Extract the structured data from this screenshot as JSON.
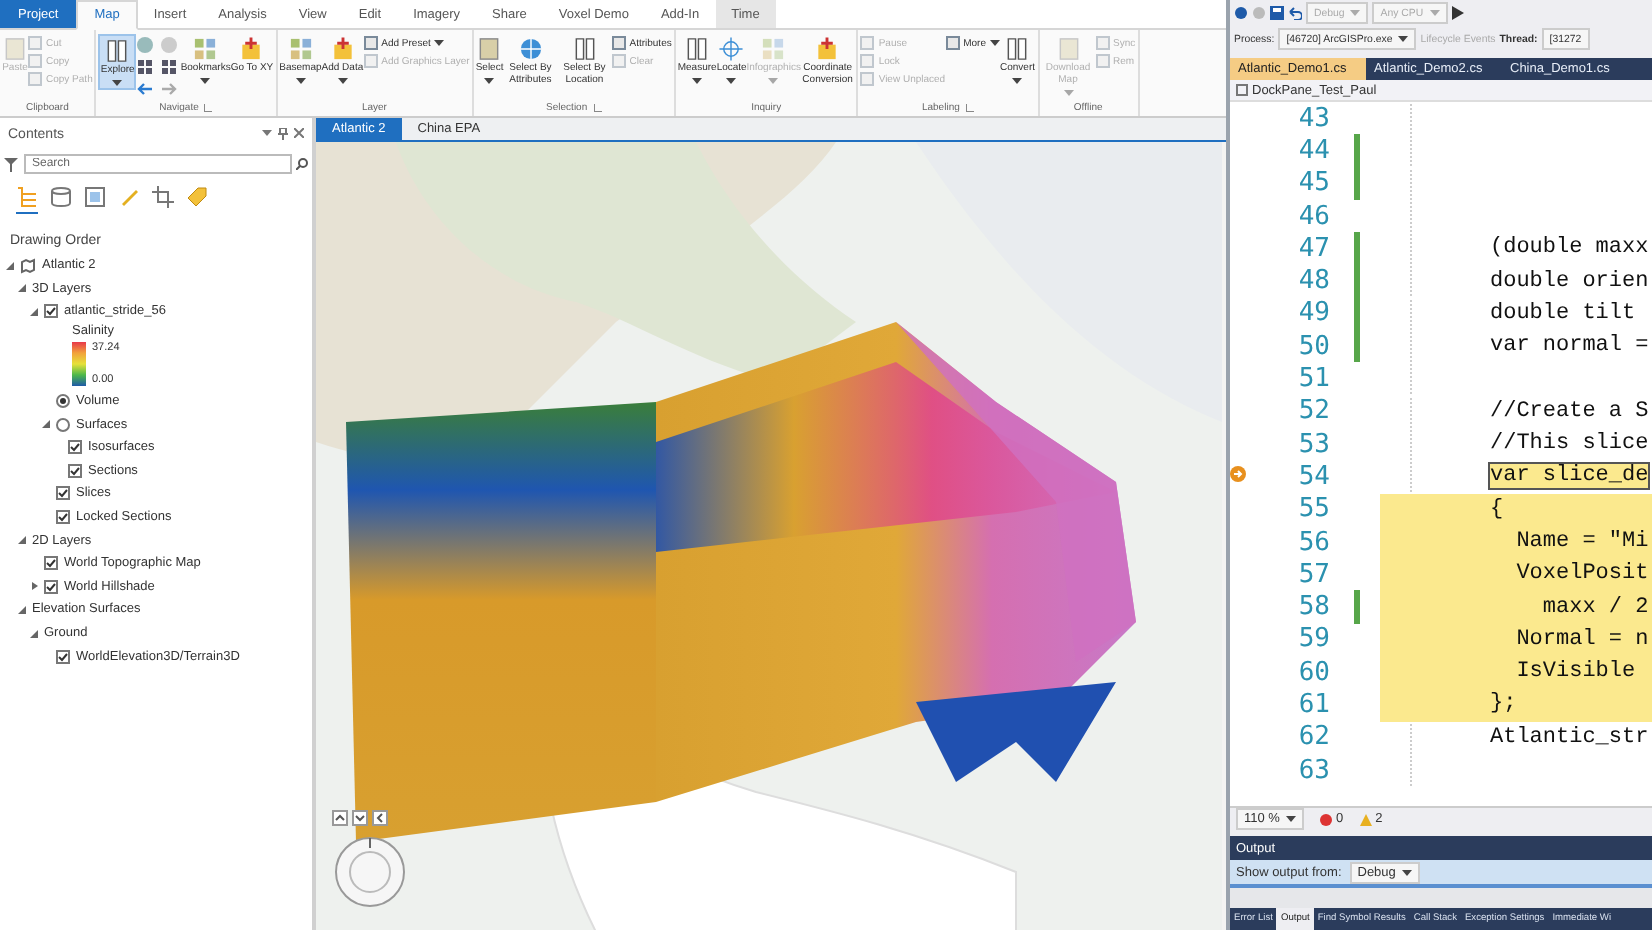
{
  "arcgis": {
    "tabs": [
      {
        "label": "Project",
        "kind": "file",
        "selected": false
      },
      {
        "label": "Map",
        "kind": "tab",
        "selected": true
      },
      {
        "label": "Insert",
        "kind": "tab",
        "selected": false
      },
      {
        "label": "Analysis",
        "kind": "tab",
        "selected": false
      },
      {
        "label": "View",
        "kind": "tab",
        "selected": false
      },
      {
        "label": "Edit",
        "kind": "tab",
        "selected": false
      },
      {
        "label": "Imagery",
        "kind": "tab",
        "selected": false
      },
      {
        "label": "Share",
        "kind": "tab",
        "selected": false
      },
      {
        "label": "Voxel Demo",
        "kind": "tab",
        "selected": false
      },
      {
        "label": "Add-In",
        "kind": "tab",
        "selected": false
      },
      {
        "label": "Time",
        "kind": "contextual",
        "selected": false
      }
    ],
    "ribbon": [
      {
        "label": "Clipboard",
        "launcher": false,
        "tools": [
          {
            "kind": "large",
            "label": "Paste",
            "disabled": true,
            "dropdown": false
          },
          {
            "kind": "small",
            "label": "Cut",
            "disabled": true,
            "dropdown": false
          },
          {
            "kind": "small",
            "label": "Copy",
            "disabled": true,
            "dropdown": false
          },
          {
            "kind": "small",
            "label": "Copy Path",
            "disabled": true,
            "dropdown": false
          }
        ]
      },
      {
        "label": "Navigate",
        "launcher": true,
        "tools": [
          {
            "kind": "large",
            "label": "Explore",
            "disabled": false,
            "dropdown": true,
            "active": true
          },
          {
            "kind": "nav_icons"
          },
          {
            "kind": "large",
            "label": "Bookmarks",
            "disabled": false,
            "dropdown": true,
            "active": false
          },
          {
            "kind": "large",
            "label": "Go To XY",
            "disabled": false,
            "dropdown": false,
            "active": false
          }
        ]
      },
      {
        "label": "Layer",
        "launcher": false,
        "tools": [
          {
            "kind": "large",
            "label": "Basemap",
            "disabled": false,
            "dropdown": true
          },
          {
            "kind": "large",
            "label": "Add Data",
            "disabled": false,
            "dropdown": true
          },
          {
            "kind": "small",
            "label": "Add Preset",
            "disabled": false,
            "dropdown": true
          },
          {
            "kind": "small",
            "label": "Add Graphics Layer",
            "disabled": true,
            "dropdown": false
          }
        ]
      },
      {
        "label": "Selection",
        "launcher": true,
        "tools": [
          {
            "kind": "large",
            "label": "Select",
            "disabled": false,
            "dropdown": true
          },
          {
            "kind": "large",
            "label": "Select By Attributes",
            "disabled": false,
            "dropdown": false
          },
          {
            "kind": "large",
            "label": "Select By Location",
            "disabled": false,
            "dropdown": false
          },
          {
            "kind": "small",
            "label": "Attributes",
            "disabled": false,
            "dropdown": false
          },
          {
            "kind": "small",
            "label": "Clear",
            "disabled": true,
            "dropdown": false
          }
        ]
      },
      {
        "label": "Inquiry",
        "launcher": false,
        "tools": [
          {
            "kind": "large",
            "label": "Measure",
            "disabled": false,
            "dropdown": true
          },
          {
            "kind": "large",
            "label": "Locate",
            "disabled": false,
            "dropdown": true
          },
          {
            "kind": "large",
            "label": "Infographics",
            "disabled": true,
            "dropdown": true
          },
          {
            "kind": "large",
            "label": "Coordinate Conversion",
            "disabled": false,
            "dropdown": false
          }
        ]
      },
      {
        "label": "Labeling",
        "launcher": true,
        "tools": [
          {
            "kind": "small",
            "label": "Pause",
            "disabled": true,
            "dropdown": false
          },
          {
            "kind": "small",
            "label": "Lock",
            "disabled": true,
            "dropdown": false
          },
          {
            "kind": "small",
            "label": "View Unplaced",
            "disabled": true,
            "dropdown": false
          },
          {
            "kind": "small",
            "label": "More",
            "disabled": false,
            "dropdown": true
          },
          {
            "kind": "large",
            "label": "Convert",
            "disabled": false,
            "dropdown": true
          }
        ]
      },
      {
        "label": "Offline",
        "launcher": false,
        "tools": [
          {
            "kind": "large",
            "label": "Download Map",
            "disabled": true,
            "dropdown": true
          },
          {
            "kind": "small",
            "label": "Sync",
            "disabled": true,
            "dropdown": false
          },
          {
            "kind": "small",
            "label": "Rem",
            "disabled": true,
            "dropdown": false
          }
        ]
      }
    ],
    "contents": {
      "title": "Contents",
      "search_placeholder": "Search",
      "view_tabs": [
        {
          "selected": true
        },
        {
          "selected": false
        },
        {
          "selected": false
        },
        {
          "selected": false
        },
        {
          "selected": false
        },
        {
          "selected": false
        }
      ],
      "heading": "Drawing Order",
      "tree": [
        {
          "label": "Atlantic 2",
          "kind": "map",
          "expanded": true,
          "children": [
            {
              "label": "3D Layers",
              "kind": "group",
              "expanded": true,
              "children": [
                {
                  "label": "atlantic_stride_56",
                  "kind": "layer",
                  "expanded": true,
                  "checked": true,
                  "legend": {
                    "title": "Salinity",
                    "max": "37.24",
                    "min": "0.00"
                  },
                  "children": [
                    {
                      "label": "Volume",
                      "kind": "option",
                      "selected": true
                    },
                    {
                      "label": "Surfaces",
                      "kind": "option",
                      "selected": false,
                      "expanded": true,
                      "children": [
                        {
                          "label": "Isosurfaces",
                          "kind": "layer",
                          "checked": true
                        },
                        {
                          "label": "Sections",
                          "kind": "layer",
                          "checked": true
                        }
                      ]
                    },
                    {
                      "label": "Slices",
                      "kind": "layer",
                      "checked": true
                    },
                    {
                      "label": "Locked Sections",
                      "kind": "layer",
                      "checked": true
                    }
                  ]
                }
              ]
            },
            {
              "label": "2D Layers",
              "kind": "group",
              "expanded": true,
              "children": [
                {
                  "label": "World Topographic Map",
                  "kind": "layer",
                  "checked": true
                },
                {
                  "label": "World Hillshade",
                  "kind": "layer",
                  "checked": true,
                  "expanded": false
                }
              ]
            },
            {
              "label": "Elevation Surfaces",
              "kind": "group",
              "expanded": true,
              "children": [
                {
                  "label": "Ground",
                  "kind": "group",
                  "expanded": true,
                  "children": [
                    {
                      "label": "WorldElevation3D/Terrain3D",
                      "kind": "layer",
                      "checked": true
                    }
                  ]
                }
              ]
            }
          ]
        }
      ]
    },
    "map": {
      "tabs": [
        {
          "label": "Atlantic 2",
          "selected": true
        },
        {
          "label": "China EPA",
          "selected": false
        }
      ]
    }
  },
  "ide": {
    "toolbar": {
      "config": "Debug",
      "platform": "Any CPU",
      "process_label": "Process:",
      "process": "[46720] ArcGISPro.exe",
      "lifecycle": "Lifecycle Events",
      "thread_label": "Thread:",
      "thread": "[31272"
    },
    "doc_tabs": [
      {
        "label": "Atlantic_Demo1.cs",
        "selected": true
      },
      {
        "label": "Atlantic_Demo2.cs",
        "selected": false
      },
      {
        "label": "China_Demo1.cs",
        "selected": false
      }
    ],
    "nav": "DockPane_Test_Paul",
    "lines": [
      {
        "number": "43",
        "changed": false,
        "filled": false,
        "outlined": false,
        "marker": false
      },
      {
        "number": "44",
        "changed": true,
        "filled": false,
        "outlined": false,
        "marker": false
      },
      {
        "number": "45",
        "changed": true,
        "filled": false,
        "outlined": false,
        "marker": false
      },
      {
        "number": "46",
        "changed": false,
        "filled": false,
        "outlined": false,
        "marker": false
      },
      {
        "number": "47",
        "text": "(double maxx",
        "changed": true,
        "filled": false,
        "outlined": false,
        "marker": false
      },
      {
        "number": "48",
        "text": "double orien",
        "changed": true,
        "filled": false,
        "outlined": false,
        "marker": false
      },
      {
        "number": "49",
        "text": "double tilt",
        "changed": true,
        "filled": false,
        "outlined": false,
        "marker": false
      },
      {
        "number": "50",
        "text": "var normal =",
        "changed": true,
        "filled": false,
        "outlined": false,
        "marker": false
      },
      {
        "number": "51",
        "changed": false,
        "filled": false,
        "outlined": false,
        "marker": false
      },
      {
        "number": "52",
        "text": "//Create a S",
        "changed": false,
        "filled": false,
        "outlined": false,
        "marker": false
      },
      {
        "number": "53",
        "text": "//This slice",
        "changed": false,
        "filled": false,
        "outlined": false,
        "marker": false
      },
      {
        "number": "54",
        "text": "var slice_de",
        "changed": false,
        "filled": false,
        "outlined": true,
        "marker": true
      },
      {
        "number": "55",
        "text": "{",
        "changed": false,
        "filled": true,
        "outlined": false,
        "marker": false
      },
      {
        "number": "56",
        "text": "  Name = \"Mi",
        "changed": false,
        "filled": true,
        "outlined": false,
        "marker": false
      },
      {
        "number": "57",
        "text": "  VoxelPosit",
        "changed": false,
        "filled": true,
        "outlined": false,
        "marker": false
      },
      {
        "number": "58",
        "text": "    maxx / 2",
        "changed": true,
        "filled": true,
        "outlined": false,
        "marker": false
      },
      {
        "number": "59",
        "text": "  Normal = n",
        "changed": false,
        "filled": true,
        "outlined": false,
        "marker": false
      },
      {
        "number": "60",
        "text": "  IsVisible",
        "changed": false,
        "filled": true,
        "outlined": false,
        "marker": false
      },
      {
        "number": "61",
        "text": "};",
        "changed": false,
        "filled": true,
        "outlined": false,
        "marker": false
      },
      {
        "number": "62",
        "text": "Atlantic_str",
        "changed": false,
        "filled": false,
        "outlined": false,
        "marker": false
      },
      {
        "number": "63",
        "changed": false,
        "filled": false,
        "outlined": false,
        "marker": false
      }
    ],
    "status": {
      "zoom": "110 %",
      "errors": "0",
      "warnings": "2"
    },
    "output": {
      "title": "Output",
      "source_label": "Show output from:",
      "source": "Debug"
    },
    "bottom_tabs": [
      {
        "label": "Error List",
        "selected": false
      },
      {
        "label": "Output",
        "selected": true
      },
      {
        "label": "Find Symbol Results",
        "selected": false
      },
      {
        "label": "Call Stack",
        "selected": false
      },
      {
        "label": "Exception Settings",
        "selected": false
      },
      {
        "label": "Immediate Wi",
        "selected": false
      }
    ]
  }
}
